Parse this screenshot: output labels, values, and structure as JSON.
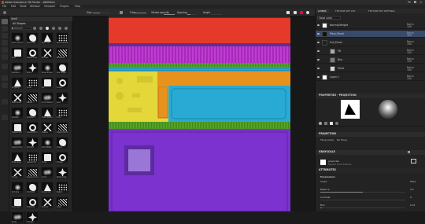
{
  "app": {
    "title": "Adobe Substance 3D Painter - WallMesh"
  },
  "menu": [
    "File",
    "Edit",
    "Mode",
    "Window",
    "Viewport",
    "Plugins",
    "Help"
  ],
  "toolbar": {
    "size_label": "Size",
    "flow_label": "Flow",
    "stroke_label": "Stroke opacity",
    "spacing_label": "Spacing",
    "angle_label": "Angle",
    "material_dropdown": "Material"
  },
  "shelf": {
    "search_placeholder": "Search",
    "title": "All Shapes",
    "tab": "Shelf",
    "items": [
      "Spot Thermal",
      "Spot Glow",
      "Spot Hard",
      "Spot Hardest",
      "Spot Smoothed",
      "Radial Lines",
      "Nuclear",
      "Biohazard",
      "Radiation",
      "Blob 1",
      "Noise Shape",
      "Star Shape",
      "Dripping",
      "Coral",
      "Pip",
      "Cloud",
      "Blob Small",
      "Pebble",
      "Circle Pattern",
      "Leaf",
      "Splatter",
      "Splatter 2",
      "Heart Pattern",
      "Octo",
      "Square Soft",
      "Square Hard",
      "Square Rounded",
      "Square Border",
      "Square Dots",
      "Dot Grid",
      "Dots Offset",
      "Check",
      "Dots Large",
      "Square Fat",
      "Cross",
      "Stripes",
      "Frame",
      "Square Circle",
      "Circle",
      "Stripe Diag",
      "Dot Row",
      "Hard Dot",
      "Round Dot",
      "Radial",
      "Cloud Soft",
      "Diamond",
      "Cloud 2",
      "Grain",
      "Spray",
      "Triangle"
    ]
  },
  "layers_panel": {
    "tabs": [
      "LAYERS",
      "TEXTURE SET LIST",
      "TEXTURE SET SETTINGS"
    ],
    "channel": "Base color",
    "layers": [
      {
        "name": "Normal/Height",
        "mode": "Norm",
        "opacity": "100"
      },
      {
        "name": "Plain_Panel",
        "mode": "Norm",
        "opacity": "100"
      },
      {
        "name": "Full_Panel",
        "mode": "Norm",
        "opacity": "100"
      },
      {
        "name": "Fill",
        "mode": "Norm",
        "opacity": "100"
      },
      {
        "name": "Blur",
        "mode": "Norm",
        "opacity": "100"
      },
      {
        "name": "Paint",
        "mode": "Norm",
        "opacity": "100"
      },
      {
        "name": "Layer 1",
        "mode": "Norm",
        "opacity": "100"
      }
    ]
  },
  "props": {
    "header": "PROPERTIES - PROJECTION",
    "projection_section": "PROJECTION",
    "projection_mode": "Tiling mode",
    "projection_value": "No Tiling",
    "grayscale_section": "GRAYSCALE",
    "grayscale_name": "grayscale",
    "grayscale_desc": "Square Hard texture",
    "attributes": "ATTRIBUTES",
    "parameters": "Parameters",
    "params": [
      {
        "name": "Invert",
        "value": "False"
      },
      {
        "name": "Balance",
        "value": "0.5"
      },
      {
        "name": "Contrast",
        "value": "0"
      },
      {
        "name": "Blur",
        "value": "0.01"
      }
    ]
  },
  "colors": {
    "red": "#e53a2a",
    "magenta": "#c13bd5",
    "green": "#5ca728",
    "yellow": "#e3d73a",
    "orange": "#e8921e",
    "blue": "#29aad4",
    "purple": "#7b32cf",
    "lightpurple": "#9a77d6",
    "accent": "#3d6cb0"
  }
}
